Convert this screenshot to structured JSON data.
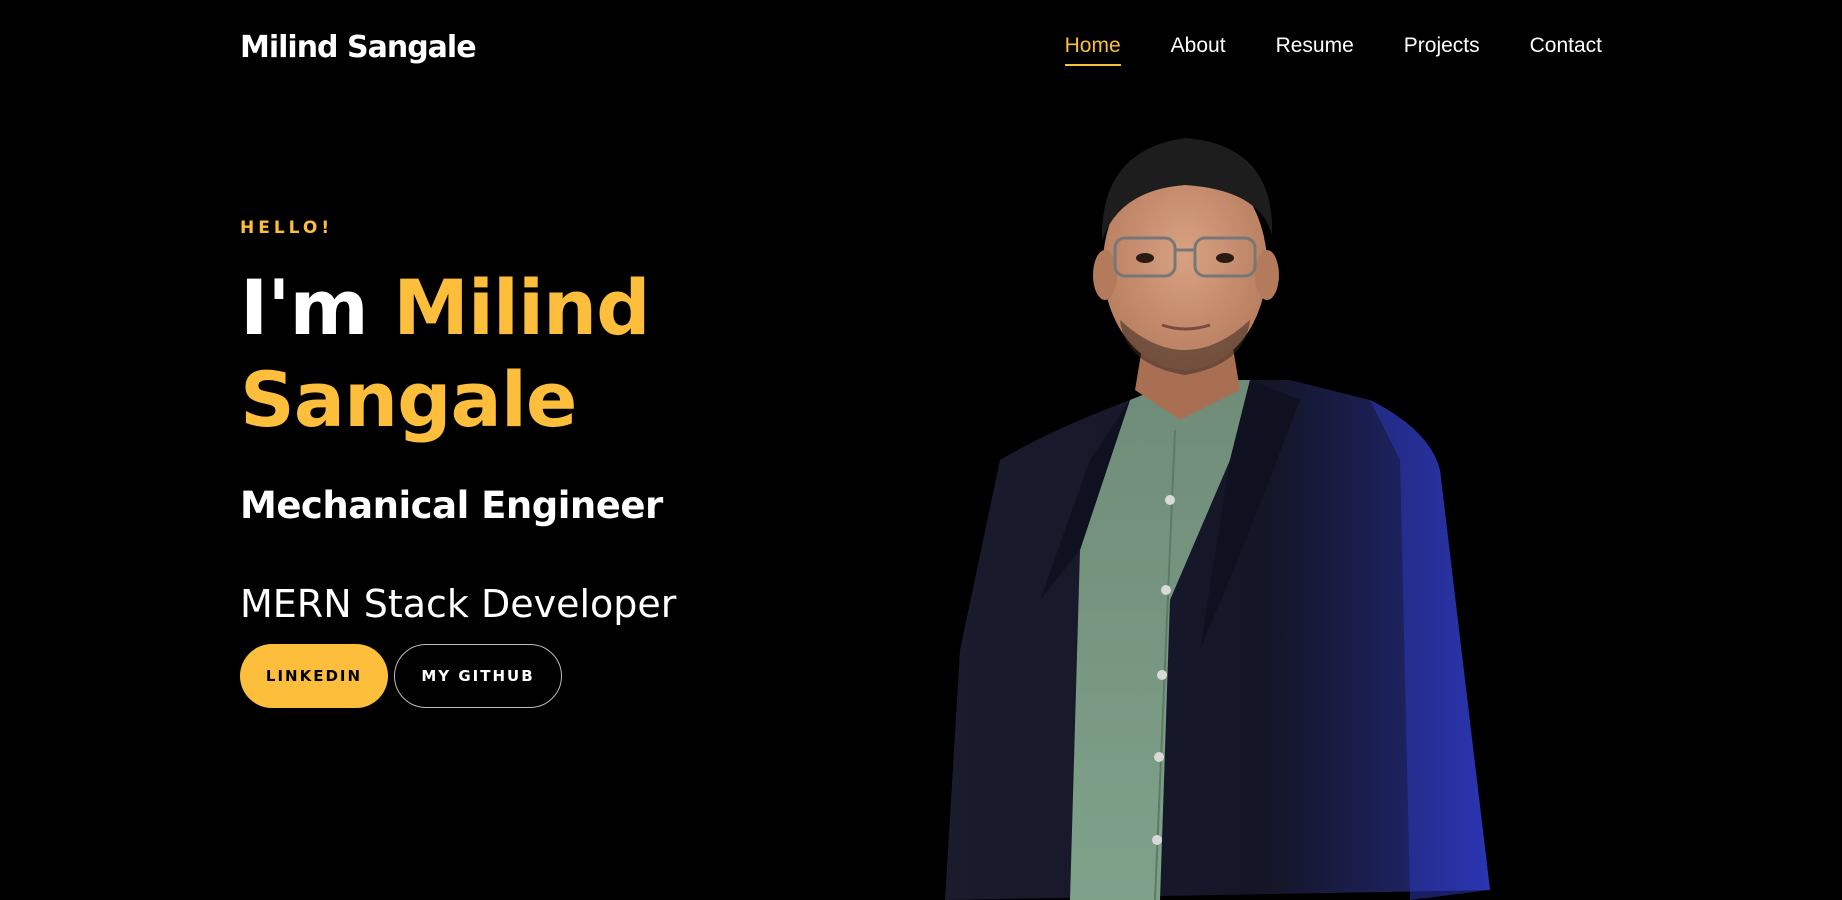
{
  "nav": {
    "brand": "Milind Sangale",
    "items": [
      {
        "label": "Home",
        "active": true
      },
      {
        "label": "About",
        "active": false
      },
      {
        "label": "Resume",
        "active": false
      },
      {
        "label": "Projects",
        "active": false
      },
      {
        "label": "Contact",
        "active": false
      }
    ]
  },
  "hero": {
    "greeting": "HELLO!",
    "intro": "I'm",
    "name_first": "Milind",
    "name_last": "Sangale",
    "role_primary": "Mechanical Engineer",
    "role_secondary": "MERN Stack Developer",
    "buttons": {
      "linkedin": "LINKEDIN",
      "github": "MY GITHUB"
    },
    "portrait_icon": "person-portrait-photo"
  },
  "colors": {
    "accent": "#fdbe3c",
    "background": "#000000",
    "text": "#ffffff"
  }
}
